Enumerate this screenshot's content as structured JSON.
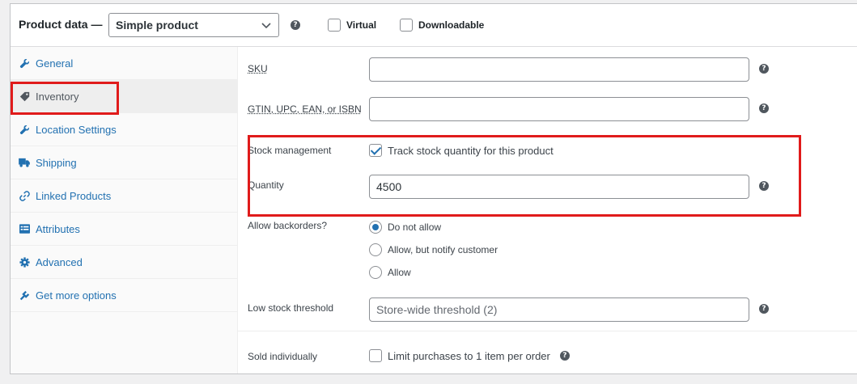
{
  "header": {
    "title": "Product data —",
    "product_type": "Simple product",
    "virtual_label": "Virtual",
    "downloadable_label": "Downloadable",
    "help_glyph": "?"
  },
  "sidebar": {
    "items": [
      {
        "label": "General",
        "icon": "wrench-icon"
      },
      {
        "label": "Inventory",
        "icon": "tag-icon",
        "active": true
      },
      {
        "label": "Location Settings",
        "icon": "wrench-icon"
      },
      {
        "label": "Shipping",
        "icon": "truck-icon"
      },
      {
        "label": "Linked Products",
        "icon": "link-icon"
      },
      {
        "label": "Attributes",
        "icon": "list-icon"
      },
      {
        "label": "Advanced",
        "icon": "gear-icon"
      },
      {
        "label": "Get more options",
        "icon": "plugin-icon"
      }
    ]
  },
  "inventory": {
    "sku": {
      "label": "SKU",
      "value": ""
    },
    "gtin": {
      "label_prefix": "GTIN, UPC, EAN, or ISBN",
      "value": ""
    },
    "stock_management": {
      "label": "Stock management",
      "checkbox_label": "Track stock quantity for this product",
      "checked": true
    },
    "quantity": {
      "label": "Quantity",
      "value": "4500"
    },
    "backorders": {
      "label": "Allow backorders?",
      "options": [
        "Do not allow",
        "Allow, but notify customer",
        "Allow"
      ],
      "selected": "Do not allow"
    },
    "low_stock": {
      "label": "Low stock threshold",
      "placeholder": "Store-wide threshold (2)"
    },
    "sold_individually": {
      "label": "Sold individually",
      "checkbox_label": "Limit purchases to 1 item per order",
      "checked": false
    }
  },
  "colors": {
    "accent": "#2271b1",
    "highlight": "#e01b1b"
  }
}
